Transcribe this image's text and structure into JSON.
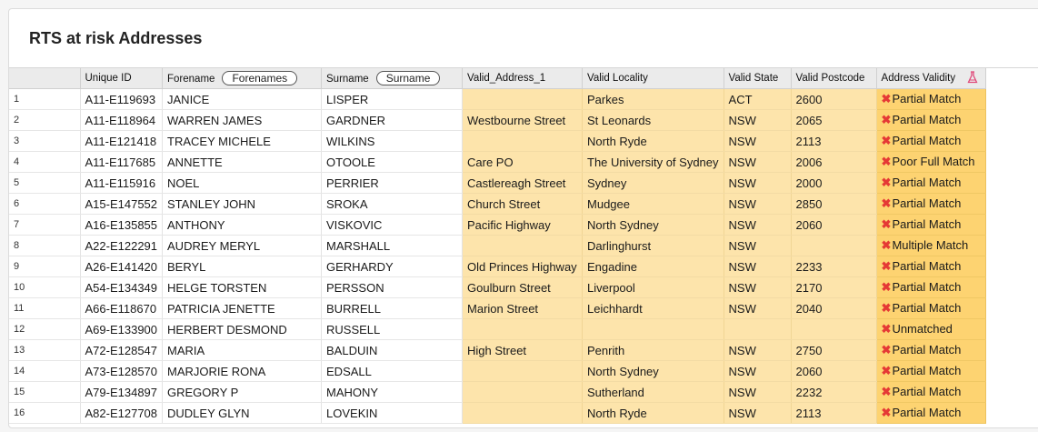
{
  "page": {
    "title": "RTS at risk Addresses"
  },
  "table": {
    "columns": {
      "uid": "Unique ID",
      "forename": "Forename",
      "forename_filter": "Forenames",
      "surname": "Surname",
      "surname_filter": "Surname",
      "addr": "Valid_Address_1",
      "locality": "Valid Locality",
      "state": "Valid State",
      "postcode": "Valid Postcode",
      "validity": "Address Validity"
    },
    "rows": [
      {
        "n": "1",
        "uid": "A11-E119693",
        "forename": "JANICE",
        "surname": "LISPER",
        "addr": "",
        "locality": "Parkes",
        "state": "ACT",
        "postcode": "2600",
        "validity": "Partial Match"
      },
      {
        "n": "2",
        "uid": "A11-E118964",
        "forename": "WARREN JAMES",
        "surname": "GARDNER",
        "addr": "Westbourne Street",
        "locality": "St Leonards",
        "state": "NSW",
        "postcode": "2065",
        "validity": "Partial Match"
      },
      {
        "n": "3",
        "uid": "A11-E121418",
        "forename": "TRACEY MICHELE",
        "surname": "WILKINS",
        "addr": "",
        "locality": "North Ryde",
        "state": "NSW",
        "postcode": "2113",
        "validity": "Partial Match"
      },
      {
        "n": "4",
        "uid": "A11-E117685",
        "forename": "ANNETTE",
        "surname": "OTOOLE",
        "addr": "Care PO",
        "locality": "The University of Sydney",
        "state": "NSW",
        "postcode": "2006",
        "validity": "Poor Full Match"
      },
      {
        "n": "5",
        "uid": "A11-E115916",
        "forename": "NOEL",
        "surname": "PERRIER",
        "addr": "Castlereagh Street",
        "locality": "Sydney",
        "state": "NSW",
        "postcode": "2000",
        "validity": "Partial Match"
      },
      {
        "n": "6",
        "uid": "A15-E147552",
        "forename": "STANLEY JOHN",
        "surname": "SROKA",
        "addr": "Church Street",
        "locality": "Mudgee",
        "state": "NSW",
        "postcode": "2850",
        "validity": "Partial Match"
      },
      {
        "n": "7",
        "uid": "A16-E135855",
        "forename": "ANTHONY",
        "surname": "VISKOVIC",
        "addr": "Pacific Highway",
        "locality": "North Sydney",
        "state": "NSW",
        "postcode": "2060",
        "validity": "Partial Match"
      },
      {
        "n": "8",
        "uid": "A22-E122291",
        "forename": "AUDREY MERYL",
        "surname": "MARSHALL",
        "addr": "",
        "locality": "Darlinghurst",
        "state": "NSW",
        "postcode": "",
        "validity": "Multiple Match"
      },
      {
        "n": "9",
        "uid": "A26-E141420",
        "forename": "BERYL",
        "surname": "GERHARDY",
        "addr": "Old Princes Highway",
        "locality": "Engadine",
        "state": "NSW",
        "postcode": "2233",
        "validity": "Partial Match"
      },
      {
        "n": "10",
        "uid": "A54-E134349",
        "forename": "HELGE TORSTEN",
        "surname": "PERSSON",
        "addr": "Goulburn Street",
        "locality": "Liverpool",
        "state": "NSW",
        "postcode": "2170",
        "validity": "Partial Match"
      },
      {
        "n": "11",
        "uid": "A66-E118670",
        "forename": "PATRICIA JENETTE",
        "surname": "BURRELL",
        "addr": "Marion Street",
        "locality": "Leichhardt",
        "state": "NSW",
        "postcode": "2040",
        "validity": "Partial Match"
      },
      {
        "n": "12",
        "uid": "A69-E133900",
        "forename": "HERBERT  DESMOND",
        "surname": "RUSSELL",
        "addr": "",
        "locality": "",
        "state": "",
        "postcode": "",
        "validity": "Unmatched"
      },
      {
        "n": "13",
        "uid": "A72-E128547",
        "forename": "MARIA",
        "surname": "BALDUIN",
        "addr": "High Street",
        "locality": "Penrith",
        "state": "NSW",
        "postcode": "2750",
        "validity": "Partial Match"
      },
      {
        "n": "14",
        "uid": "A73-E128570",
        "forename": "MARJORIE RONA",
        "surname": "EDSALL",
        "addr": "",
        "locality": "North Sydney",
        "state": "NSW",
        "postcode": "2060",
        "validity": "Partial Match"
      },
      {
        "n": "15",
        "uid": "A79-E134897",
        "forename": "GREGORY P",
        "surname": "MAHONY",
        "addr": "",
        "locality": "Sutherland",
        "state": "NSW",
        "postcode": "2232",
        "validity": "Partial Match"
      },
      {
        "n": "16",
        "uid": "A82-E127708",
        "forename": "DUDLEY GLYN",
        "surname": "LOVEKIN",
        "addr": "",
        "locality": "North Ryde",
        "state": "NSW",
        "postcode": "2113",
        "validity": "Partial Match"
      }
    ]
  }
}
